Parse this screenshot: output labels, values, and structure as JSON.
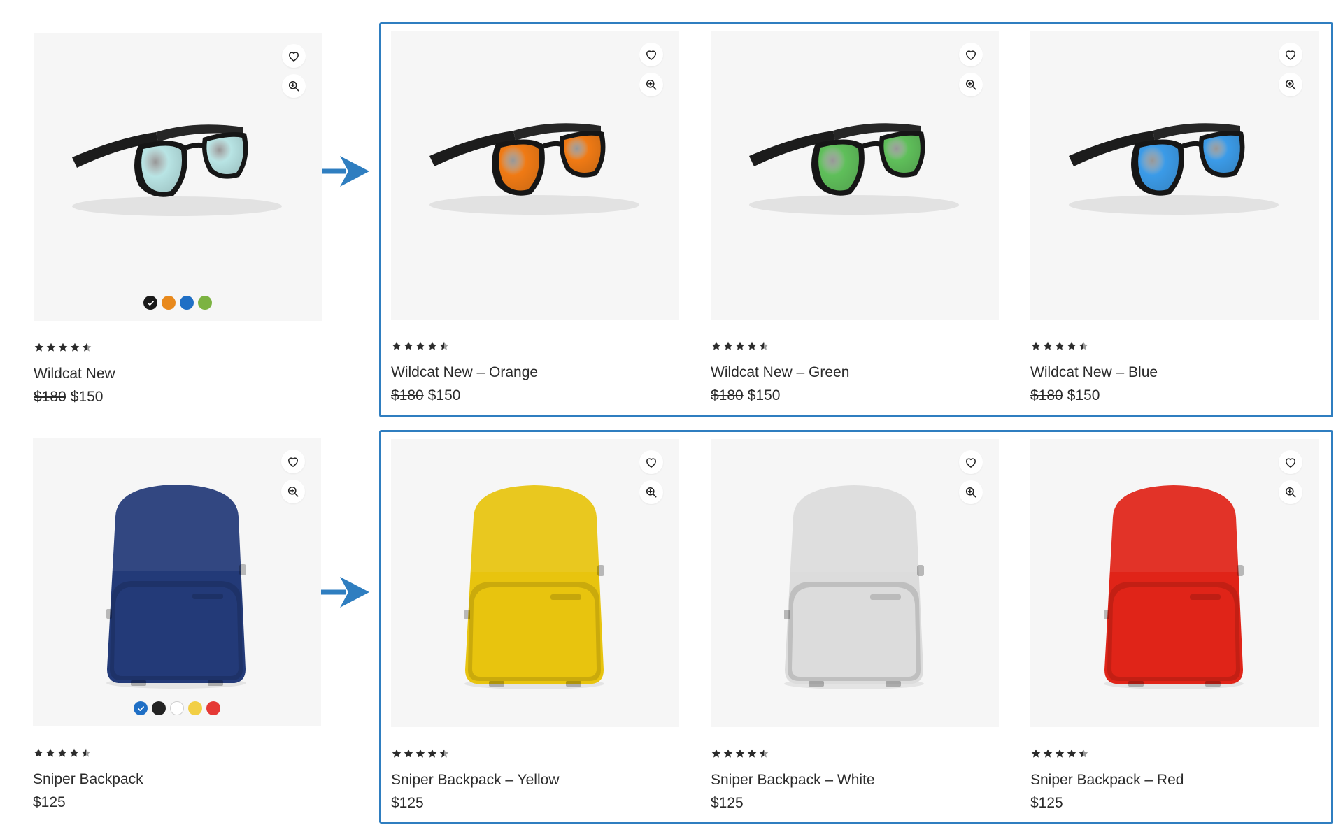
{
  "accent": "#2f7ec0",
  "rows": [
    {
      "source": {
        "name": "Wildcat New",
        "old_price": "$180",
        "price": "$150",
        "rating": 4.5,
        "swatches": [
          "#1a1a1a",
          "#e8891c",
          "#1f6fc5",
          "#7cb342"
        ],
        "selected_swatch": 0,
        "product": "sunglasses",
        "lens": "#b8e4e4"
      },
      "variants": [
        {
          "name": "Wildcat New – Orange",
          "old_price": "$180",
          "price": "$150",
          "rating": 4.5,
          "product": "sunglasses",
          "lens": "#f07a14"
        },
        {
          "name": "Wildcat New – Green",
          "old_price": "$180",
          "price": "$150",
          "rating": 4.5,
          "product": "sunglasses",
          "lens": "#5fbf5a"
        },
        {
          "name": "Wildcat New – Blue",
          "old_price": "$180",
          "price": "$150",
          "rating": 4.5,
          "product": "sunglasses",
          "lens": "#3b9be8"
        }
      ]
    },
    {
      "source": {
        "name": "Sniper Backpack",
        "price": "$125",
        "rating": 4.5,
        "swatches": [
          "#1f6fc5",
          "#222222",
          "#ffffff",
          "#f2cf45",
          "#e53935"
        ],
        "selected_swatch": 0,
        "product": "backpack",
        "body": "#233a78"
      },
      "variants": [
        {
          "name": "Sniper Backpack – Yellow",
          "price": "$125",
          "rating": 4.5,
          "product": "backpack",
          "body": "#e8c40e"
        },
        {
          "name": "Sniper Backpack – White",
          "price": "$125",
          "rating": 4.5,
          "product": "backpack",
          "body": "#dcdcdc"
        },
        {
          "name": "Sniper Backpack – Red",
          "price": "$125",
          "rating": 4.5,
          "product": "backpack",
          "body": "#e02418"
        }
      ]
    }
  ]
}
